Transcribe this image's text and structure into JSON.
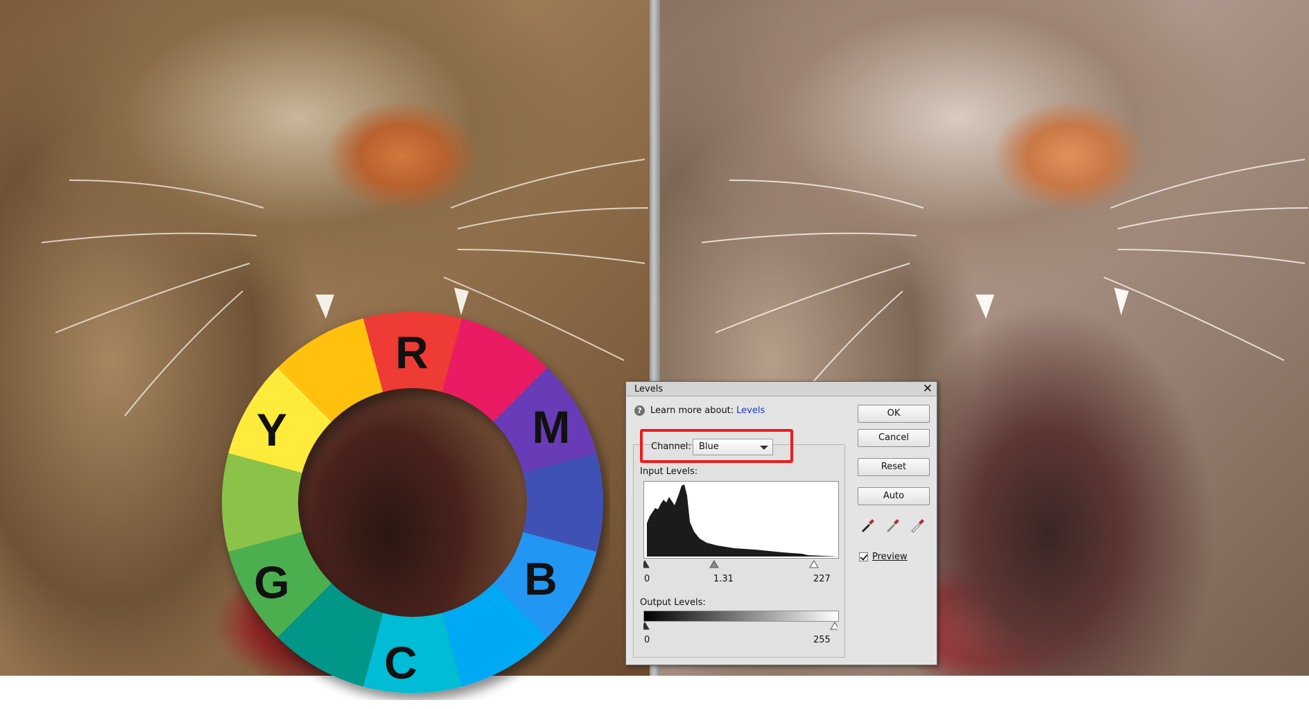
{
  "wheel": {
    "letters": {
      "r": "R",
      "m": "M",
      "b": "B",
      "c": "C",
      "g": "G",
      "y": "Y"
    },
    "colors": {
      "red": "#ef3b36",
      "pink": "#e91e63",
      "purple": "#673ab7",
      "indigo": "#3f51b5",
      "blue": "#2196f3",
      "sky": "#03a9f4",
      "cyan": "#00bcd4",
      "teal": "#009688",
      "green": "#4caf50",
      "lime": "#8bc34a",
      "yellow": "#ffeb3b",
      "amber": "#ffc107"
    }
  },
  "dialog": {
    "title": "Levels",
    "help_text": "Learn more about:",
    "help_link": "Levels",
    "buttons": {
      "ok": "OK",
      "cancel": "Cancel",
      "reset": "Reset",
      "auto": "Auto"
    },
    "channel_label": "Channel:",
    "channel_value": "Blue",
    "input_label": "Input Levels:",
    "input_black": "0",
    "input_gamma": "1.31",
    "input_white": "227",
    "output_label": "Output Levels:",
    "output_black": "0",
    "output_white": "255",
    "preview_label": "Preview",
    "preview_checked": true,
    "highlight_color": "#ee1b1b"
  }
}
